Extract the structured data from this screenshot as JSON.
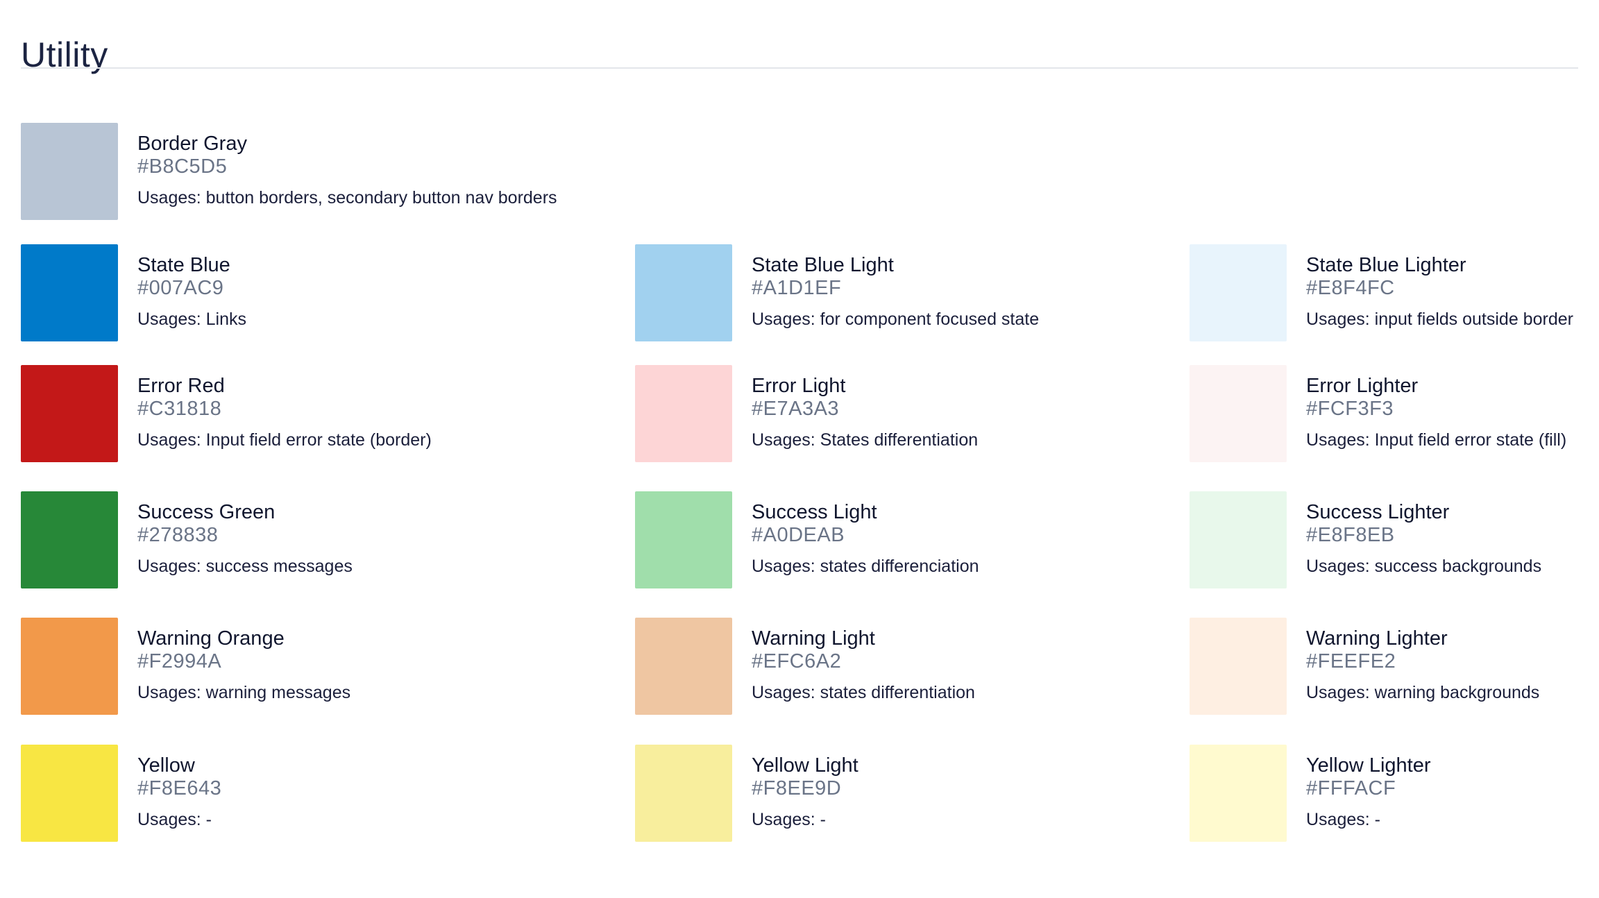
{
  "title": "Utility",
  "swatches": [
    {
      "name": "Border Gray",
      "hex": "#B8C5D5",
      "usage": "Usages: button borders, secondary button nav borders",
      "color": "#B8C5D5"
    },
    {
      "name": "State Blue",
      "hex": "#007AC9",
      "usage": "Usages: Links",
      "color": "#007AC9"
    },
    {
      "name": "State Blue Light",
      "hex": "#A1D1EF",
      "usage": "Usages: for component focused state",
      "color": "#A1D1EF"
    },
    {
      "name": "State Blue Lighter",
      "hex": "#E8F4FC",
      "usage": "Usages: input fields outside border",
      "color": "#E8F4FC"
    },
    {
      "name": "Error Red",
      "hex": "#C31818",
      "usage": "Usages: Input field error state (border)",
      "color": "#C31818"
    },
    {
      "name": "Error Light",
      "hex": "#E7A3A3",
      "usage": "Usages: States differentiation",
      "color": "#FDD5D6"
    },
    {
      "name": "Error Lighter",
      "hex": "#FCF3F3",
      "usage": "Usages: Input field error state (fill)",
      "color": "#FCF3F3"
    },
    {
      "name": "Success Green",
      "hex": "#278838",
      "usage": "Usages: success messages",
      "color": "#278838"
    },
    {
      "name": "Success Light",
      "hex": "#A0DEAB",
      "usage": "Usages: states differenciation",
      "color": "#A0DEAB"
    },
    {
      "name": "Success Lighter",
      "hex": "#E8F8EB",
      "usage": "Usages: success backgrounds",
      "color": "#E8F8EB"
    },
    {
      "name": "Warning Orange",
      "hex": "#F2994A",
      "usage": "Usages: warning messages",
      "color": "#F2994A"
    },
    {
      "name": "Warning Light",
      "hex": "#EFC6A2",
      "usage": "Usages: states differentiation",
      "color": "#EFC6A2"
    },
    {
      "name": "Warning Lighter",
      "hex": "#FEEFE2",
      "usage": "Usages: warning backgrounds",
      "color": "#FEEFE2"
    },
    {
      "name": "Yellow",
      "hex": "#F8E643",
      "usage": "Usages: -",
      "color": "#F8E643"
    },
    {
      "name": "Yellow Light",
      "hex": "#F8EE9D",
      "usage": "Usages: -",
      "color": "#F8EE9D"
    },
    {
      "name": "Yellow Lighter",
      "hex": "#FFFACF",
      "usage": "Usages: -",
      "color": "#FFFACF"
    }
  ]
}
